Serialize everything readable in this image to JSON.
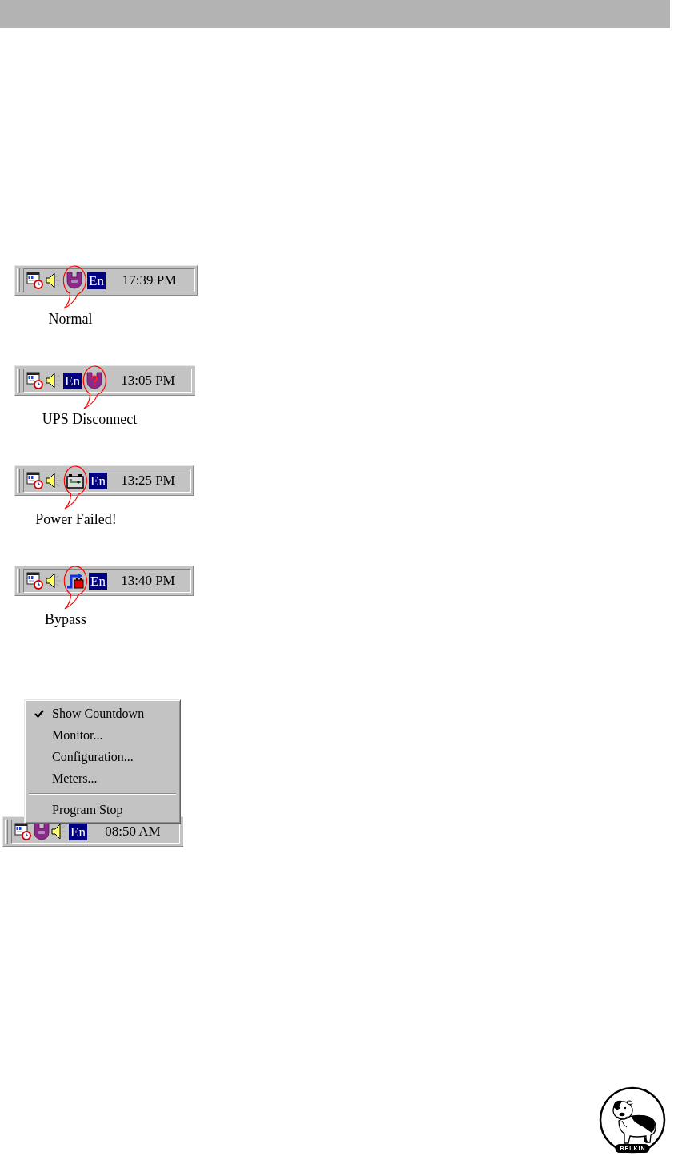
{
  "status_examples": [
    {
      "tray": {
        "icons": [
          {
            "kind": "scheduler",
            "highlighted": false
          },
          {
            "kind": "speaker",
            "highlighted": false
          },
          {
            "kind": "ups",
            "highlighted": true
          },
          {
            "kind": "language",
            "label": "En",
            "highlighted": false
          }
        ],
        "time": "17:39 PM"
      },
      "caption": "Normal"
    },
    {
      "tray": {
        "icons": [
          {
            "kind": "scheduler",
            "highlighted": false
          },
          {
            "kind": "speaker",
            "highlighted": false
          },
          {
            "kind": "language",
            "label": "En",
            "highlighted": false
          },
          {
            "kind": "ups_disconnected",
            "highlighted": true
          }
        ],
        "time": "13:05 PM"
      },
      "caption": "UPS Disconnect"
    },
    {
      "tray": {
        "icons": [
          {
            "kind": "scheduler",
            "highlighted": false
          },
          {
            "kind": "speaker",
            "highlighted": false
          },
          {
            "kind": "battery",
            "highlighted": true
          },
          {
            "kind": "language",
            "label": "En",
            "highlighted": false
          }
        ],
        "time": "13:25 PM"
      },
      "caption": "Power Failed!"
    },
    {
      "tray": {
        "icons": [
          {
            "kind": "scheduler",
            "highlighted": false
          },
          {
            "kind": "speaker",
            "highlighted": false
          },
          {
            "kind": "bypass",
            "highlighted": true
          },
          {
            "kind": "language",
            "label": "En",
            "highlighted": false
          }
        ],
        "time": "13:40 PM"
      },
      "caption": "Bypass"
    }
  ],
  "context_menu": {
    "groups": [
      [
        {
          "label": "Show Countdown",
          "checked": true
        },
        {
          "label": "Monitor...",
          "checked": false
        },
        {
          "label": "Configuration...",
          "checked": false
        },
        {
          "label": "Meters...",
          "checked": false
        }
      ],
      [
        {
          "label": "Program Stop",
          "checked": false
        }
      ]
    ]
  },
  "menu_tray": {
    "icons": [
      {
        "kind": "scheduler",
        "highlighted": false
      },
      {
        "kind": "ups",
        "highlighted": false
      },
      {
        "kind": "speaker",
        "highlighted": false
      },
      {
        "kind": "language",
        "label": "En",
        "highlighted": false
      }
    ],
    "time": "08:50 AM"
  },
  "logo": {
    "label": "BELKIN"
  }
}
